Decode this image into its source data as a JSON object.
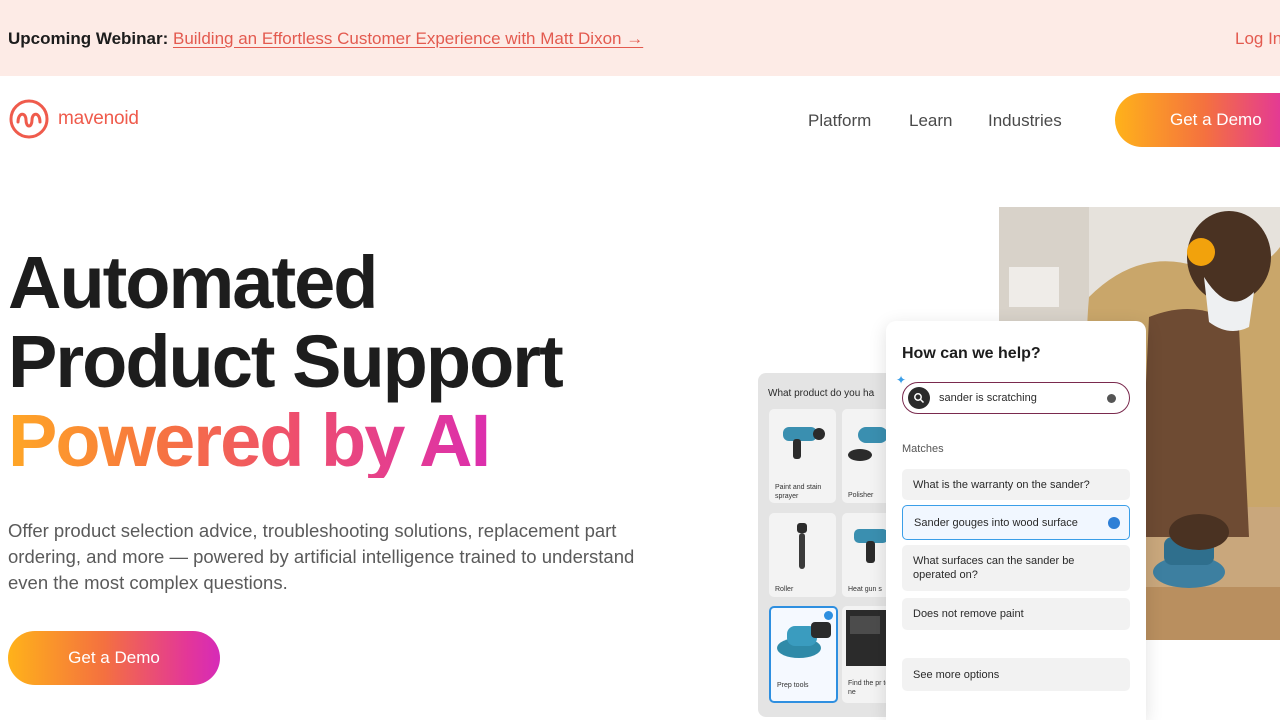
{
  "banner": {
    "label": "Upcoming Webinar:",
    "link_text": "Building an Effortless Customer Experience with Matt Dixon →",
    "login": "Log In"
  },
  "nav": {
    "logo_text": "mavenoid",
    "items": [
      "Platform",
      "Learn",
      "Industries"
    ],
    "cta": "Get a Demo"
  },
  "hero": {
    "line1": "Automated",
    "line2": "Product Support",
    "line3": "Powered by AI",
    "description": "Offer product selection advice, troubleshooting solutions, replacement part ordering, and more — powered by artificial intelligence trained to understand even the most complex questions.",
    "cta": "Get a Demo"
  },
  "picker": {
    "title": "What product do you ha",
    "tiles": [
      {
        "label": "Paint and stain sprayer"
      },
      {
        "label": "Polisher"
      },
      {
        "label": "Roller"
      },
      {
        "label": "Heat gun s"
      },
      {
        "label": "Prep tools"
      },
      {
        "label": "Find the pr tool you ne"
      }
    ]
  },
  "help": {
    "title": "How can we help?",
    "search_value": "sander is scratching",
    "matches_label": "Matches",
    "options": [
      "What is the warranty on the sander?",
      "Sander gouges into wood surface",
      "What surfaces can the sander be operated on?",
      "Does not remove paint"
    ],
    "more": "See more options"
  },
  "colors": {
    "brand": "#ef5b4c",
    "banner_bg": "#fdebe6",
    "accent_blue": "#3a9ee8",
    "gradient": [
      "#ffb21a",
      "#f4713f",
      "#e33699"
    ]
  }
}
